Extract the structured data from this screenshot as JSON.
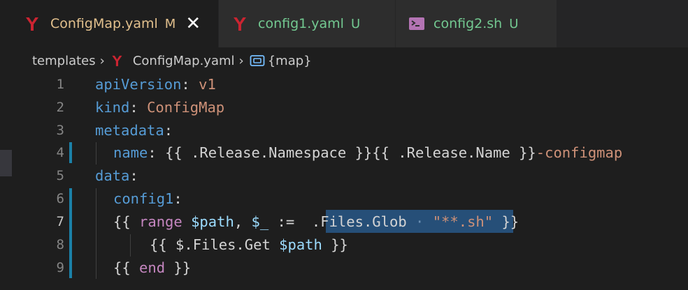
{
  "tabs": [
    {
      "label": "ConfigMap.yaml",
      "status": "M",
      "icon": "yaml-icon",
      "label_color": "#e2c08d",
      "active": true
    },
    {
      "label": "config1.yaml",
      "status": "U",
      "icon": "yaml-icon",
      "label_color": "#73c991",
      "active": false
    },
    {
      "label": "config2.sh",
      "status": "U",
      "icon": "terminal-icon",
      "label_color": "#73c991",
      "active": false
    }
  ],
  "breadcrumb": {
    "folder": "templates",
    "file": "ConfigMap.yaml",
    "symbol": "{map}"
  },
  "editor": {
    "current_line": 7,
    "lines": [
      {
        "n": "1"
      },
      {
        "n": "2"
      },
      {
        "n": "3"
      },
      {
        "n": "4"
      },
      {
        "n": "5"
      },
      {
        "n": "6"
      },
      {
        "n": "7"
      },
      {
        "n": "8"
      },
      {
        "n": "9"
      }
    ],
    "code": {
      "l1": {
        "key": "apiVersion",
        "colon": ": ",
        "value": "v1"
      },
      "l2": {
        "key": "kind",
        "colon": ": ",
        "value": "ConfigMap"
      },
      "l3": {
        "key": "metadata",
        "colon": ":"
      },
      "l4": {
        "key": "name",
        "colon": ": ",
        "value": "{{ .Release.Namespace }}{{ .Release.Name }}",
        "suffix": "-configmap"
      },
      "l5": {
        "key": "data",
        "colon": ":"
      },
      "l6": {
        "key": "config1",
        "colon": ":"
      },
      "l7": {
        "open": "{{ ",
        "range": "range",
        "path": " $path",
        "comma": ", ",
        "underscore": "$_",
        "assign": " :=  ",
        "files": ".Files.Glob",
        "dots": " · ",
        "glob": "\"**.sh\"",
        "close": " }}"
      },
      "l8": {
        "open": "{{ ",
        "ident": "$.Files.Get",
        "path": " $path",
        "close": " }}"
      },
      "l9": {
        "open": "{{ ",
        "end": "end",
        "close": " }}"
      }
    }
  },
  "colors": {
    "editor_bg": "#1e1e1e",
    "modified_gutter": "#1b81a8",
    "selection_highlight": "#264f78",
    "yaml_icon": "#cb2431"
  }
}
